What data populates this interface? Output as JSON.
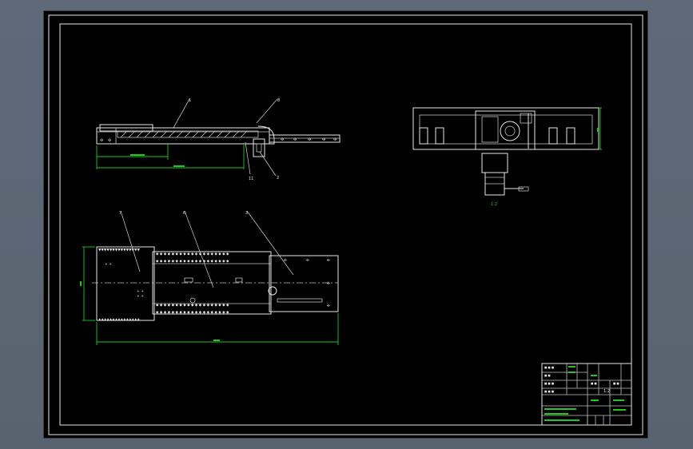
{
  "drawing": {
    "background": "#000000",
    "frame_color": "#e6e6e6",
    "dimension_color": "#1ec81e",
    "side_view": {
      "balloons": [
        "1",
        "8",
        "11",
        "2"
      ]
    },
    "end_view": {
      "label": "1:2"
    },
    "top_view": {
      "balloons": [
        "7",
        "6",
        "3"
      ]
    },
    "title_block": {
      "scale": "1:2"
    }
  }
}
